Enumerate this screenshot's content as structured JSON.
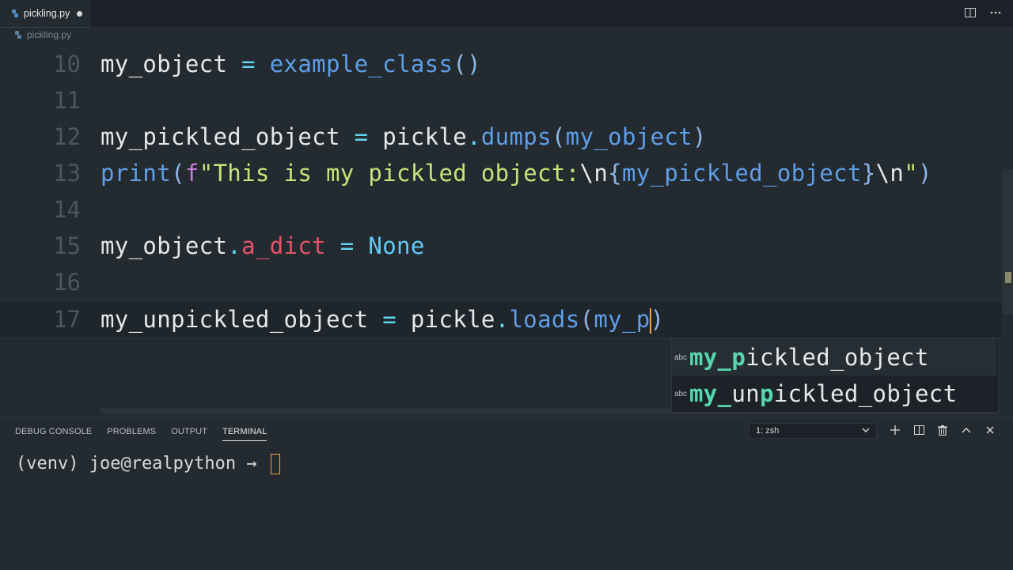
{
  "tab": {
    "filename": "pickling.py"
  },
  "breadcrumb": {
    "filename": "pickling.py"
  },
  "editor": {
    "lines": [
      {
        "number": "10",
        "tokens": [
          [
            "var",
            "my_object"
          ],
          [
            "txt",
            " "
          ],
          [
            "op",
            "="
          ],
          [
            "txt",
            " "
          ],
          [
            "fn",
            "example_class"
          ],
          [
            "punc",
            "()"
          ]
        ]
      },
      {
        "number": "11",
        "tokens": []
      },
      {
        "number": "12",
        "tokens": [
          [
            "var",
            "my_pickled_object"
          ],
          [
            "txt",
            " "
          ],
          [
            "op",
            "="
          ],
          [
            "txt",
            " "
          ],
          [
            "var",
            "pickle"
          ],
          [
            "op",
            "."
          ],
          [
            "fn",
            "dumps"
          ],
          [
            "punc",
            "("
          ],
          [
            "fn",
            "my_object"
          ],
          [
            "punc",
            ")"
          ]
        ]
      },
      {
        "number": "13",
        "tokens": [
          [
            "fn",
            "print"
          ],
          [
            "punc",
            "("
          ],
          [
            "fpre",
            "f"
          ],
          [
            "str",
            "\"This is my pickled object:"
          ],
          [
            "esc",
            "\\n"
          ],
          [
            "punc",
            "{"
          ],
          [
            "fn",
            "my_pickled_object"
          ],
          [
            "punc",
            "}"
          ],
          [
            "esc",
            "\\n"
          ],
          [
            "str",
            "\""
          ],
          [
            "punc",
            ")"
          ]
        ]
      },
      {
        "number": "14",
        "tokens": []
      },
      {
        "number": "15",
        "tokens": [
          [
            "var",
            "my_object"
          ],
          [
            "op",
            "."
          ],
          [
            "attr",
            "a_dict"
          ],
          [
            "txt",
            " "
          ],
          [
            "op",
            "="
          ],
          [
            "txt",
            " "
          ],
          [
            "kw",
            "None"
          ]
        ]
      },
      {
        "number": "16",
        "tokens": []
      },
      {
        "number": "17",
        "tokens": [
          [
            "var",
            "my_unpickled_object"
          ],
          [
            "txt",
            " "
          ],
          [
            "op",
            "="
          ],
          [
            "txt",
            " "
          ],
          [
            "var",
            "pickle"
          ],
          [
            "op",
            "."
          ],
          [
            "fn",
            "loads"
          ],
          [
            "punc",
            "("
          ],
          [
            "fn",
            "my_p"
          ],
          [
            "cursor",
            ""
          ],
          [
            "punc",
            ")"
          ]
        ]
      }
    ]
  },
  "suggestions": [
    {
      "kind": "abc",
      "match": "my_p",
      "rest": "ickled_object",
      "selected": true
    },
    {
      "kind": "abc",
      "match_pre": "my_",
      "mid": "un",
      "match": "p",
      "rest": "ickled_object",
      "selected": false
    }
  ],
  "panel": {
    "tabs": [
      "DEBUG CONSOLE",
      "PROBLEMS",
      "OUTPUT",
      "TERMINAL"
    ],
    "active_tab": "TERMINAL",
    "terminal_select": "1: zsh",
    "prompt": "(venv) joe@realpython → "
  }
}
